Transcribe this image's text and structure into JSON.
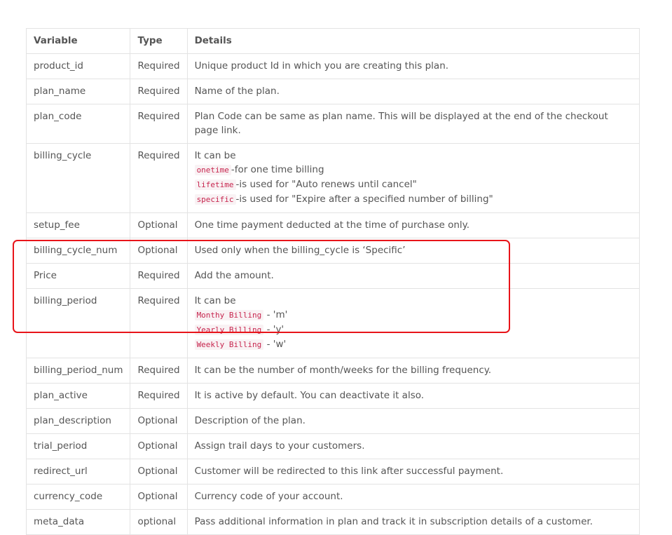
{
  "table": {
    "headers": [
      "Variable",
      "Type",
      "Details"
    ],
    "rows": [
      {
        "variable": "product_id",
        "type": "Required",
        "details": "Unique product Id in which you are creating this plan."
      },
      {
        "variable": "plan_name",
        "type": "Required",
        "details": "Name of the plan."
      },
      {
        "variable": "plan_code",
        "type": "Required",
        "details": "Plan Code can be same as plan name. This will be displayed at the end of the checkout page link."
      },
      {
        "variable": "billing_cycle",
        "type": "Required",
        "details": "It can be",
        "items": [
          {
            "code": "onetime",
            "text": "-for one time billing"
          },
          {
            "code": "lifetime",
            "text": "-is used for \"Auto renews until cancel\""
          },
          {
            "code": "specific",
            "text": "-is used for \"Expire after a specified number of billing\""
          }
        ]
      },
      {
        "variable": "setup_fee",
        "type": "Optional",
        "details": "One time payment deducted at the time of purchase only."
      },
      {
        "variable": "billing_cycle_num",
        "type": "Optional",
        "details": "Used only when the billing_cycle is ‘Specific’"
      },
      {
        "variable": "Price",
        "type": "Required",
        "details": "Add the amount."
      },
      {
        "variable": "billing_period",
        "type": "Required",
        "details": "It can be",
        "items": [
          {
            "code": "Monthy Billing",
            "text": " - 'm'"
          },
          {
            "code": "Yearly Billing",
            "text": " - 'y'"
          },
          {
            "code": "Weekly Billing",
            "text": " - 'w'"
          }
        ]
      },
      {
        "variable": "billing_period_num",
        "type": "Required",
        "details": "It can be the number of month/weeks for the billing frequency."
      },
      {
        "variable": "plan_active",
        "type": "Required",
        "details": "It is active by default. You can deactivate it also."
      },
      {
        "variable": "plan_description",
        "type": "Optional",
        "details": "Description of the plan."
      },
      {
        "variable": "trial_period",
        "type": "Optional",
        "details": "Assign trail days to your customers."
      },
      {
        "variable": "redirect_url",
        "type": "Optional",
        "details": "Customer will be redirected to this link after successful payment."
      },
      {
        "variable": "currency_code",
        "type": "Optional",
        "details": "Currency code of your account."
      },
      {
        "variable": "meta_data",
        "type": "optional",
        "details": "Pass additional information in plan and track it in subscription details of a customer."
      }
    ]
  },
  "highlight": {
    "color": "#e8141a"
  }
}
